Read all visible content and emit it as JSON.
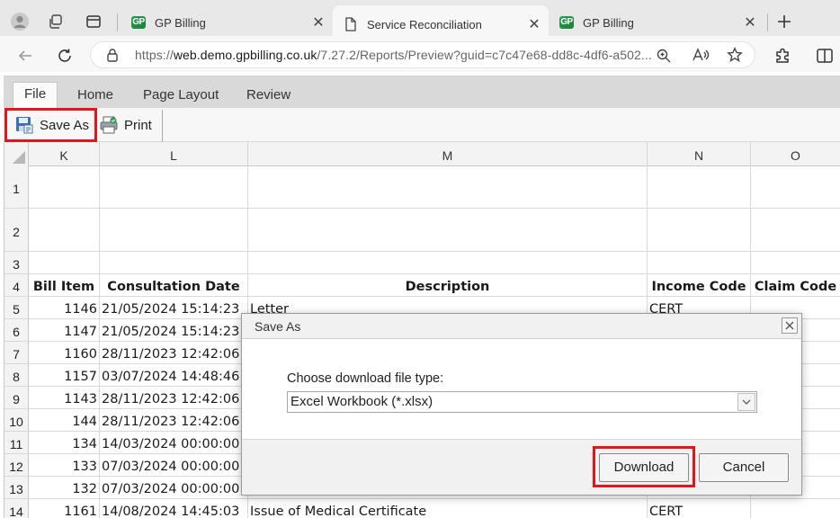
{
  "browser": {
    "tabs": [
      {
        "title": "GP Billing",
        "active": false
      },
      {
        "title": "Service Reconciliation",
        "active": true
      },
      {
        "title": "GP Billing",
        "active": false
      }
    ],
    "url_prefix": "https://",
    "url_host": "web.demo.gpbilling.co.uk",
    "url_rest": "/7.27.2/Reports/Preview?guid=c7c47e68-dd8c-4df6-a502..."
  },
  "ribbon": {
    "tabs": [
      "File",
      "Home",
      "Page Layout",
      "Review"
    ],
    "active_tab": "File",
    "save_as_label": "Save As",
    "print_label": "Print"
  },
  "grid": {
    "columns": [
      "K",
      "L",
      "M",
      "N",
      "O"
    ],
    "rows": [
      {
        "num": "1",
        "cells": [
          "",
          "",
          "",
          "",
          ""
        ]
      },
      {
        "num": "2",
        "cells": [
          "",
          "",
          "",
          "",
          ""
        ]
      },
      {
        "num": "3",
        "cells": [
          "",
          "",
          "",
          "",
          ""
        ]
      },
      {
        "num": "4",
        "cells": [
          "Bill Item",
          "Consultation Date",
          "Description",
          "Income Code",
          "Claim Code"
        ]
      },
      {
        "num": "5",
        "cells": [
          "1146",
          "21/05/2024 15:14:23",
          "Letter",
          "CERT",
          ""
        ]
      },
      {
        "num": "6",
        "cells": [
          "1147",
          "21/05/2024 15:14:23",
          "",
          "",
          ""
        ]
      },
      {
        "num": "7",
        "cells": [
          "1160",
          "28/11/2023 12:42:06",
          "",
          "",
          ""
        ]
      },
      {
        "num": "8",
        "cells": [
          "1157",
          "03/07/2024 14:48:46",
          "",
          "",
          ""
        ]
      },
      {
        "num": "9",
        "cells": [
          "1143",
          "28/11/2023 12:42:06",
          "",
          "",
          ""
        ]
      },
      {
        "num": "10",
        "cells": [
          "144",
          "28/11/2023 12:42:06",
          "",
          "",
          ""
        ]
      },
      {
        "num": "11",
        "cells": [
          "134",
          "14/03/2024 00:00:00",
          "",
          "",
          ""
        ]
      },
      {
        "num": "12",
        "cells": [
          "133",
          "07/03/2024 00:00:00",
          "",
          "",
          ""
        ]
      },
      {
        "num": "13",
        "cells": [
          "132",
          "07/03/2024 00:00:00",
          "",
          "",
          ""
        ]
      },
      {
        "num": "14",
        "cells": [
          "1161",
          "14/08/2024 14:45:03",
          "Issue of Medical Certificate",
          "CERT",
          ""
        ]
      }
    ]
  },
  "dialog": {
    "title": "Save As",
    "label": "Choose download file type:",
    "selected_type": "Excel Workbook (*.xlsx)",
    "download_label": "Download",
    "cancel_label": "Cancel"
  },
  "colors": {
    "highlight": "#e2141c",
    "gp_green": "#2a9d4a"
  }
}
